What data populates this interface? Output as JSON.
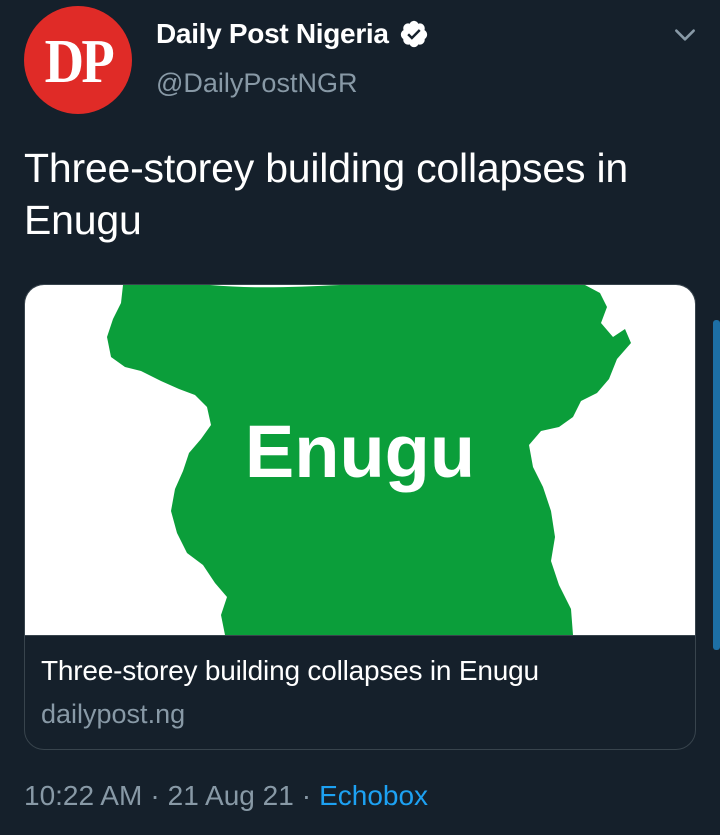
{
  "author": {
    "avatar_text": "DP",
    "display_name": "Daily Post Nigeria",
    "handle": "@DailyPostNGR",
    "verified": true,
    "avatar_color": "#e02b27"
  },
  "tweet": {
    "text": "Three-storey building collapses in Enugu"
  },
  "card": {
    "image_label": "Enugu",
    "title": "Three-storey building collapses in Enugu",
    "domain": "dailypost.ng",
    "map_color": "#0b9e3a"
  },
  "meta": {
    "time": "10:22 AM",
    "separator": "·",
    "date": "21 Aug 21",
    "source": "Echobox"
  },
  "icons": {
    "verified": "verified-badge-icon",
    "menu": "chevron-down-icon"
  },
  "colors": {
    "background": "#15202b",
    "secondary_text": "#8899a6",
    "link": "#1da1f2"
  }
}
